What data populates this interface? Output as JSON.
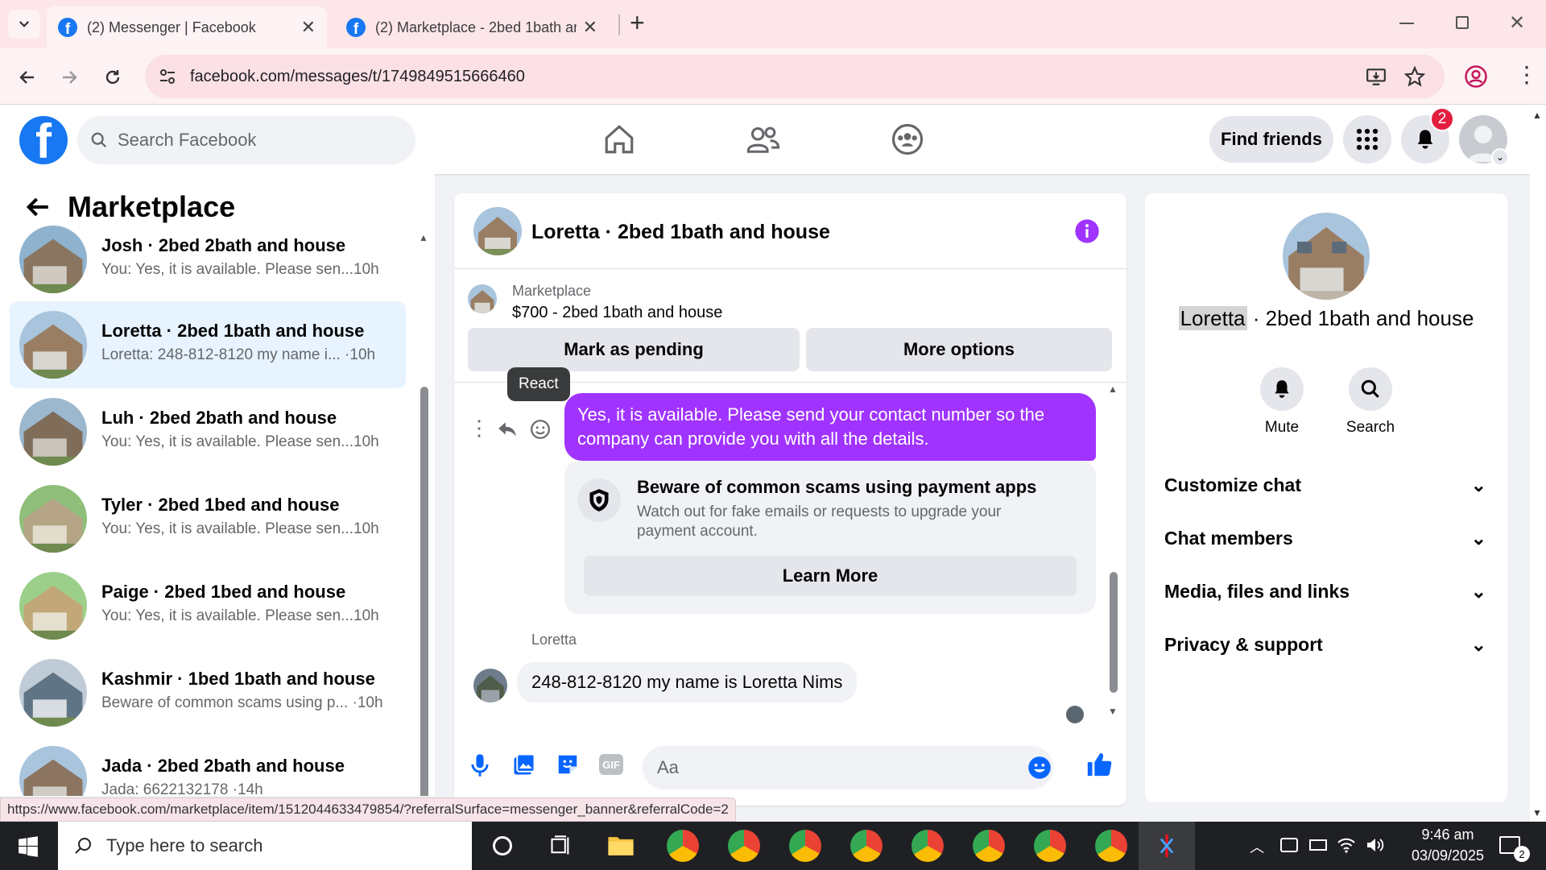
{
  "browser": {
    "tabs": [
      {
        "title": "(2) Messenger | Facebook",
        "active": true
      },
      {
        "title": "(2) Marketplace - 2bed 1bath ar",
        "active": false
      }
    ],
    "new_tab": "+",
    "url": "facebook.com/messages/t/1749849515666460",
    "status_url": "https://www.facebook.com/marketplace/item/1512044633479854/?referralSurface=messenger_banner&referralCode=2"
  },
  "fb": {
    "logo": "f",
    "search_placeholder": "Search Facebook",
    "find_friends": "Find friends",
    "notif_count": "2"
  },
  "left": {
    "title": "Marketplace",
    "conversations": [
      {
        "name": "Josh · 2bed 2bath and house",
        "preview": "You: Yes, it is available. Please sen...",
        "time": "10h"
      },
      {
        "name": "Loretta · 2bed 1bath and house",
        "preview": "Loretta: 248-812-8120 my name i... ·",
        "time": "10h"
      },
      {
        "name": "Luh · 2bed 2bath and house",
        "preview": "You: Yes, it is available. Please sen...",
        "time": "10h"
      },
      {
        "name": "Tyler · 2bed 1bed and house",
        "preview": "You: Yes, it is available. Please sen...",
        "time": "10h"
      },
      {
        "name": "Paige · 2bed 1bed and house",
        "preview": "You: Yes, it is available. Please sen...",
        "time": "10h"
      },
      {
        "name": "Kashmir · 1bed 1bath and house",
        "preview": "Beware of common scams using p... ·",
        "time": "10h"
      },
      {
        "name": "Jada · 2bed 2bath and house",
        "preview": "Jada: 6622132178 ·",
        "time": "14h"
      }
    ]
  },
  "chat": {
    "title": "Loretta · 2bed 1bath and house",
    "listing_source": "Marketplace",
    "listing_title": "$700 - 2bed 1bath and house",
    "mark_pending": "Mark as pending",
    "more_options": "More options",
    "react_tooltip": "React",
    "sent_message": "Yes, it is available. Please send your contact number so the company can provide you with all the details.",
    "warning_title": "Beware of common scams using payment apps",
    "warning_body": "Watch out for fake emails or requests to upgrade your payment account.",
    "learn_more": "Learn More",
    "sender_name": "Loretta",
    "received_message": "248-812-8120 my name is Loretta Nims",
    "composer_placeholder": "Aa"
  },
  "right": {
    "name_highlight": "Loretta",
    "name_rest": " · 2bed 1bath and house",
    "mute": "Mute",
    "search": "Search",
    "sections": [
      "Customize chat",
      "Chat members",
      "Media, files and links",
      "Privacy & support"
    ]
  },
  "taskbar": {
    "search_placeholder": "Type here to search",
    "time": "9:46 am",
    "date": "03/09/2025",
    "notif": "2"
  },
  "colors": {
    "fb_blue": "#1877f2",
    "messenger_purple": "#a033ff",
    "selected_bg": "#e7f3ff"
  }
}
